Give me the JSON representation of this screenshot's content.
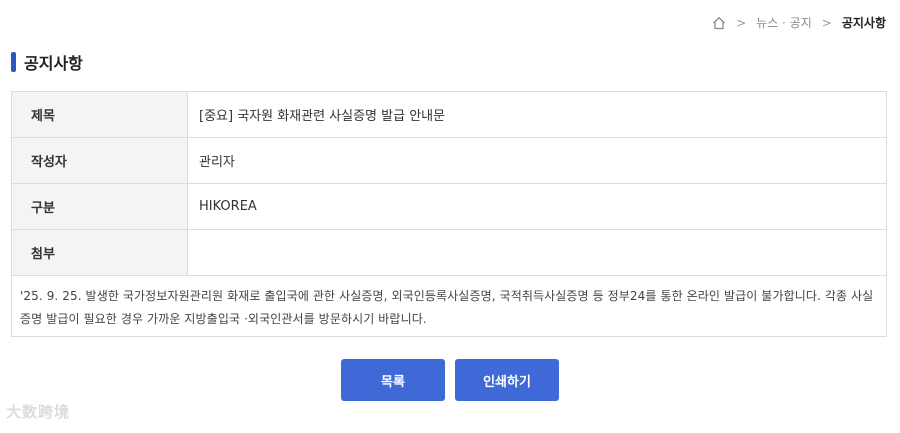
{
  "breadcrumb": {
    "home_icon": "home-icon",
    "items": [
      "뉴스 · 공지",
      "공지사항"
    ]
  },
  "page_title": "공지사항",
  "notice": {
    "rows": [
      {
        "label": "제목",
        "value": "[중요] 국자원 화재관련 사실증명 발급 안내문"
      },
      {
        "label": "작성자",
        "value": "관리자"
      },
      {
        "label": "구분",
        "value": "HIKOREA"
      },
      {
        "label": "첨부",
        "value": ""
      }
    ],
    "content": "'25. 9. 25. 발생한 국가정보자원관리원 화재로 출입국에 관한 사실증명, 외국인등록사실증명, 국적취득사실증명 등 정부24를 통한 온라인 발급이 불가합니다. 각종 사실증명 발급이 필요한 경우 가까운 지방출입국 ·외국인관서를 방문하시기 바랍니다."
  },
  "buttons": {
    "list_label": "목록",
    "print_label": "인쇄하기"
  },
  "watermark": "大数跨境",
  "colors": {
    "accent": "#3f69d6",
    "title_bar": "#2e57c6",
    "header_cell_bg": "#f4f4f4",
    "border": "#dcdcdc"
  }
}
